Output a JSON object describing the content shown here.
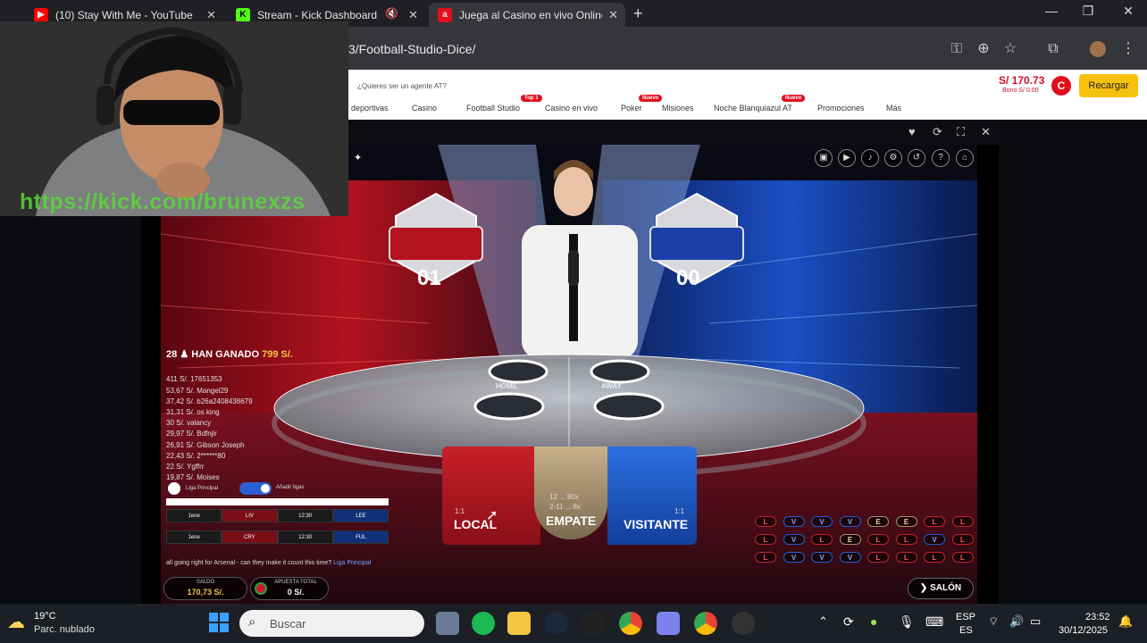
{
  "tabs": [
    {
      "label": "(10) Stay With Me - YouTube",
      "icon": "youtube-icon"
    },
    {
      "label": "Stream - Kick Dashboard",
      "icon": "kick-icon"
    },
    {
      "label": "Juega al Casino en vivo Online",
      "icon": "casino-icon"
    }
  ],
  "address": {
    "url": "3/Football-Studio-Dice/"
  },
  "site": {
    "agent_prompt": "¿Quieres ser un agente AT?",
    "nav": [
      "deportivas",
      "Casino",
      "Football Studio",
      "Casino en vivo",
      "Poker",
      "Misiones",
      "Noche Blanquiazul AT",
      "Promociones",
      "Más"
    ],
    "badges": {
      "football_studio": "Top 1",
      "poker": "Nuevo",
      "noche": "Nuevo"
    },
    "balance": "S/ 170.73",
    "bono": "Bono S/ 0.00",
    "avatar_letter": "C",
    "recharge_label": "Recargar"
  },
  "stream_overlay": {
    "link": "https://kick.com/brunexzs"
  },
  "game": {
    "score_home": "01",
    "score_away": "00",
    "table_home": "HOME",
    "table_away": "AWAY",
    "winners_count": "28",
    "winners_text": "HAN GANADO",
    "winners_total": "799 S/.",
    "winners": [
      "411 S/. 17651353",
      "53,67 S/. Mangel29",
      "37,42 S/. b26a2408438679",
      "31,31 S/. os king",
      "30 S/. valancy",
      "29,97 S/. Bdfnjir",
      "26,91 S/. Gibson Joseph",
      "22,43 S/. 2******80",
      "22 S/. Ygffrr",
      "19,87 S/. Moises"
    ],
    "league_label": "Liga Principal",
    "add_league": "Añadir ligas",
    "matches": [
      [
        "1ene",
        "LIV",
        "12:30",
        "LEE"
      ],
      [
        "1ene",
        "CRY",
        "12:30",
        "FUL"
      ]
    ],
    "chat_message": "all going right for Arsenal - can they make it count this time?",
    "chat_tag": "Liga Principal",
    "saldo_label": "SALDO",
    "saldo_value": "170,73 S/.",
    "apuesta_label": "APUESTA TOTAL",
    "apuesta_value": "0 S/.",
    "bets": {
      "local_odds": "1:1",
      "local_label": "LOCAL",
      "empate_odds1": "12 ... 80x",
      "empate_odds2": "2-11 ... 8x",
      "empate_label": "EMPATE",
      "visitante_odds": "1:1",
      "visitante_label": "VISITANTE"
    },
    "history": [
      [
        "L",
        "V",
        "V",
        "V",
        "E",
        "E",
        "L",
        "L"
      ],
      [
        "L",
        "V",
        "L",
        "E",
        "L",
        "L",
        "V",
        "L"
      ],
      [
        "L",
        "V",
        "V",
        "V",
        "L",
        "L",
        "L",
        "L"
      ]
    ],
    "lobby_label": "SALÓN",
    "colors": {
      "local": "#c8202a",
      "visitante": "#1f5fd1",
      "empate": "#a8906a",
      "gold": "#f5c542"
    }
  },
  "taskbar": {
    "weather_temp": "19°C",
    "weather_desc": "Parc. nublado",
    "search_placeholder": "Buscar",
    "lang1": "ESP",
    "lang2": "ES",
    "time": "23:52",
    "date": "30/12/2025"
  }
}
